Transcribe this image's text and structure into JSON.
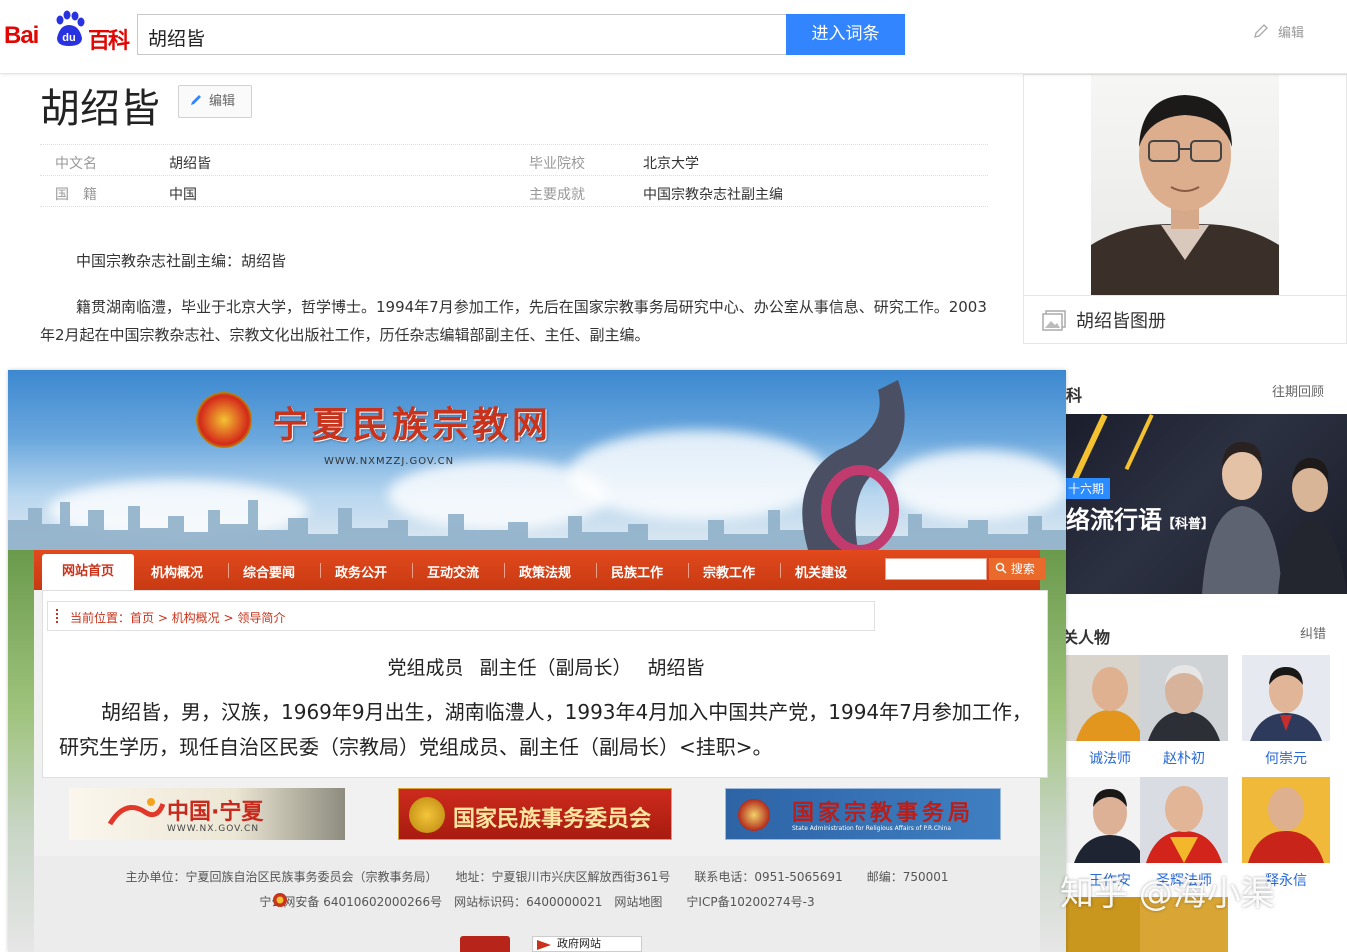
{
  "header": {
    "logo_bai": "Bai",
    "logo_du": "du",
    "logo_baike": "百科",
    "search_value": "胡绍皆",
    "search_button": "进入词条",
    "edit_label": "编辑"
  },
  "article": {
    "title": "胡绍皆",
    "edit_button": "编辑",
    "basic_info": [
      {
        "key": "中文名",
        "value": "胡绍皆"
      },
      {
        "key": "国　籍",
        "value": "中国"
      },
      {
        "key": "毕业院校",
        "value": "北京大学"
      },
      {
        "key": "主要成就",
        "value": "中国宗教杂志社副主编"
      }
    ],
    "para1": "中国宗教杂志社副主编：胡绍皆",
    "para2": "籍贯湖南临澧，毕业于北京大学，哲学博士。1994年7月参加工作，先后在国家宗教事务局研究中心、办公室从事信息、研究工作。2003年2月起在中国宗教杂志社、宗教文化出版社工作，历任杂志编辑部副主任、主任、副主编。"
  },
  "sidebar": {
    "album_label": "胡绍皆图册",
    "section1_title": "科",
    "section1_link": "往期回顾",
    "banner_period": "十六期",
    "banner_text": "络流行语",
    "banner_tag": "【科普】",
    "section2_title": "关人物",
    "section2_link": "纠错",
    "people": [
      "诚法师",
      "赵朴初",
      "何崇元",
      "王作安",
      "圣辉法师",
      "释永信"
    ]
  },
  "embedded_site": {
    "site_title": "宁夏民族宗教网",
    "site_url": "WWW.NXMZZJ.GOV.CN",
    "nav": [
      "网站首页",
      "机构概况",
      "综合要闻",
      "政务公开",
      "互动交流",
      "政策法规",
      "民族工作",
      "宗教工作",
      "机关建设"
    ],
    "search_button": "搜索",
    "breadcrumb": "当前位置：首页 > 机构概况 > 领导简介",
    "leader_title": "党组成员 副主任（副局长） 胡绍皆",
    "leader_bio": "胡绍皆，男，汉族，1969年9月出生，湖南临澧人，1993年4月加入中国共产党，1994年7月参加工作，研究生学历，现任自治区民委（宗教局）党组成员、副主任（副局长）<挂职>。",
    "logos": {
      "logo1": "中国·宁夏",
      "logo1_sub": "WWW.NX.GOV.CN",
      "logo2": "国家民族事务委员会",
      "logo3": "国家宗教事务局",
      "logo3_sub": "State Administration for Religious Affairs of P.R.China"
    },
    "footer_line1": "主办单位：宁夏回族自治区民族事务委员会（宗教事务局）　　地址：宁夏银川市兴庆区解放西街361号　　联系电话：0951-5065691　　邮编：750001",
    "footer_line2": "宁公网安备 64010602000266号　网站标识码：6400000021　网站地图　　宁ICP备10200274号-3",
    "footer_badge_text": "政府网站"
  },
  "watermark": "知乎 @海小渠",
  "colors": {
    "baidu_red": "#e10602",
    "baidu_blue": "#3385ff",
    "site_red": "#c9321b"
  }
}
